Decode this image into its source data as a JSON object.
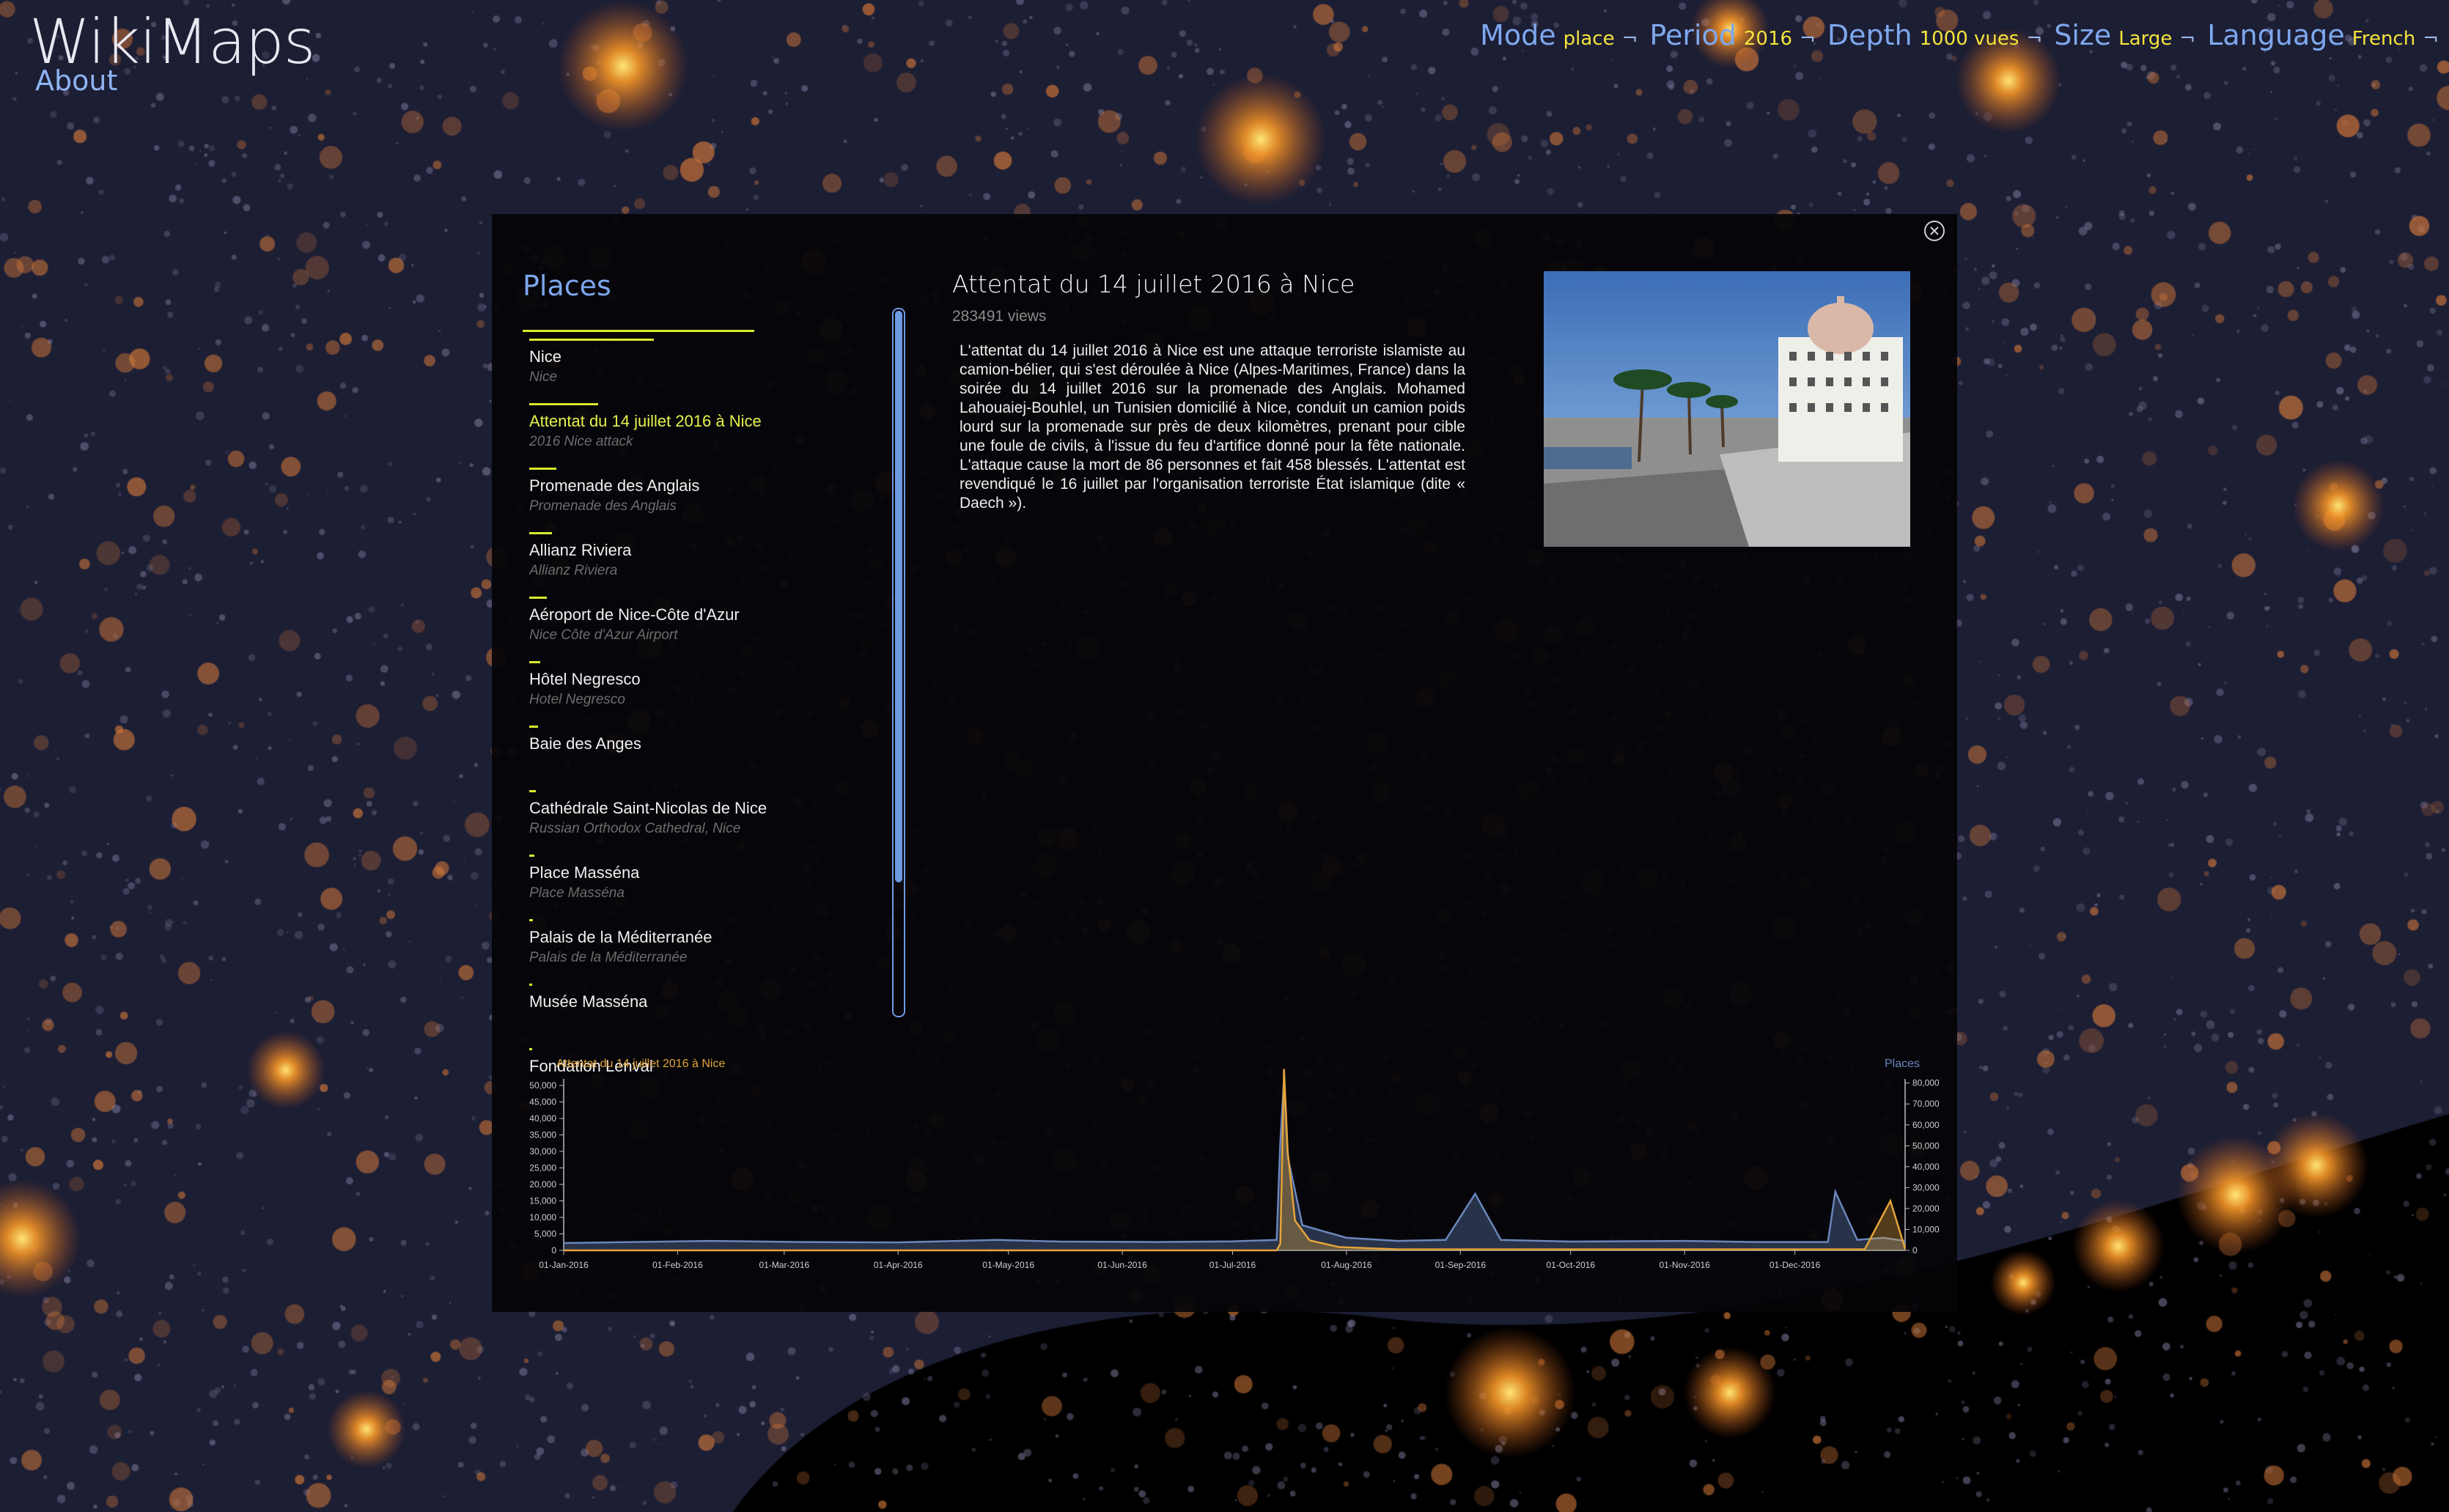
{
  "brand": {
    "title": "WikiMaps",
    "about": "About"
  },
  "nav": [
    {
      "label": "Mode",
      "value": "place"
    },
    {
      "label": "Period",
      "value": "2016"
    },
    {
      "label": "Depth",
      "value": "1000 vues"
    },
    {
      "label": "Size",
      "value": "Large"
    },
    {
      "label": "Language",
      "value": "French"
    }
  ],
  "nav_separator": "¬",
  "places": {
    "title": "Places",
    "items": [
      {
        "name": "Nice",
        "sub": "Nice",
        "weight": 1.0
      },
      {
        "name": "Attentat du 14 juillet 2016 à Nice",
        "sub": "2016 Nice attack",
        "weight": 0.55,
        "active": true
      },
      {
        "name": "Promenade des Anglais",
        "sub": "Promenade des Anglais",
        "weight": 0.22
      },
      {
        "name": "Allianz Riviera",
        "sub": "Allianz Riviera",
        "weight": 0.18
      },
      {
        "name": "Aéroport de Nice-Côte d'Azur",
        "sub": "Nice Côte d'Azur Airport",
        "weight": 0.14
      },
      {
        "name": "Hôtel Negresco",
        "sub": "Hotel Negresco",
        "weight": 0.09
      },
      {
        "name": "Baie des Anges",
        "sub": "",
        "weight": 0.07
      },
      {
        "name": "Cathédrale Saint-Nicolas de Nice",
        "sub": "Russian Orthodox Cathedral, Nice",
        "weight": 0.05
      },
      {
        "name": "Place Masséna",
        "sub": "Place Masséna",
        "weight": 0.04
      },
      {
        "name": "Palais de la Méditerranée",
        "sub": "Palais de la Méditerranée",
        "weight": 0.03
      },
      {
        "name": "Musée Masséna",
        "sub": "",
        "weight": 0.02
      },
      {
        "name": "Fondation Lenval",
        "sub": "",
        "weight": 0.015
      }
    ]
  },
  "article": {
    "title": "Attentat du 14 juillet 2016 à Nice",
    "views": "283491 views",
    "body": "L'attentat du 14 juillet 2016 à Nice est une attaque terroriste islamiste au camion-bélier, qui s'est déroulée à Nice (Alpes-Maritimes, France) dans la soirée du 14 juillet 2016 sur la promenade des Anglais. Mohamed Lahouaiej-Bouhlel, un Tunisien domicilié à Nice, conduit un camion poids lourd sur la promenade sur près de deux kilomètres, prenant pour cible une foule de civils, à l'issue du feu d'artifice donné pour la fête nationale. L'attaque cause la mort de 86 personnes et fait 458 blessés. L'attentat est revendiqué le 16 juillet par l'organisation terroriste État islamique (dite « Daech »).",
    "image_alt": "Hôtel Negresco on the Promenade des Anglais"
  },
  "colors": {
    "accent": "#d9ea2c",
    "nav_label": "#7ea8ee",
    "nav_value": "#f4e33c",
    "series_place": "#e3a43a",
    "series_places": "#6b86bc",
    "panel": "#040408"
  },
  "chart_data": {
    "type": "line",
    "left_series_label": "Attentat du 14 juillet 2016 à Nice",
    "right_series_label": "Places",
    "x_ticks": [
      "01-Jan-2016",
      "01-Feb-2016",
      "01-Mar-2016",
      "01-Apr-2016",
      "01-May-2016",
      "01-Jun-2016",
      "01-Jul-2016",
      "01-Aug-2016",
      "01-Sep-2016",
      "01-Oct-2016",
      "01-Nov-2016",
      "01-Dec-2016"
    ],
    "y_left_ticks": [
      "0",
      "5,000",
      "10,000",
      "15,000",
      "20,000",
      "25,000",
      "30,000",
      "35,000",
      "40,000",
      "45,000",
      "50,000"
    ],
    "y_right_ticks": [
      "0",
      "10,000",
      "20,000",
      "30,000",
      "40,000",
      "50,000",
      "60,000",
      "70,000",
      "80,000"
    ],
    "ylim_left": [
      0,
      52000
    ],
    "ylim_right": [
      0,
      82000
    ],
    "xlim": [
      "2016-01-01",
      "2016-12-31"
    ],
    "series": [
      {
        "name": "Attentat du 14 juillet 2016 à Nice",
        "axis": "left",
        "x": [
          "2016-01-01",
          "2016-07-13",
          "2016-07-14",
          "2016-07-15",
          "2016-07-16",
          "2016-07-18",
          "2016-07-22",
          "2016-07-30",
          "2016-08-15",
          "2016-12-20",
          "2016-12-27",
          "2016-12-31"
        ],
        "y": [
          0,
          0,
          2000,
          55000,
          30000,
          9000,
          3000,
          1000,
          300,
          300,
          15000,
          500
        ]
      },
      {
        "name": "Places",
        "axis": "right",
        "x": [
          "2016-01-01",
          "2016-01-20",
          "2016-02-10",
          "2016-03-05",
          "2016-04-01",
          "2016-04-28",
          "2016-05-15",
          "2016-06-10",
          "2016-07-01",
          "2016-07-13",
          "2016-07-14",
          "2016-07-15",
          "2016-07-16",
          "2016-07-20",
          "2016-08-01",
          "2016-08-15",
          "2016-08-28",
          "2016-09-05",
          "2016-09-12",
          "2016-10-01",
          "2016-11-01",
          "2016-11-20",
          "2016-12-10",
          "2016-12-12",
          "2016-12-18",
          "2016-12-25",
          "2016-12-31"
        ],
        "y": [
          3500,
          4000,
          4500,
          4000,
          3800,
          5000,
          4200,
          4000,
          4300,
          5000,
          52000,
          82000,
          45000,
          12000,
          6000,
          4500,
          5000,
          27000,
          5000,
          4200,
          4500,
          4000,
          4000,
          28000,
          5000,
          6000,
          4500
        ]
      }
    ]
  }
}
